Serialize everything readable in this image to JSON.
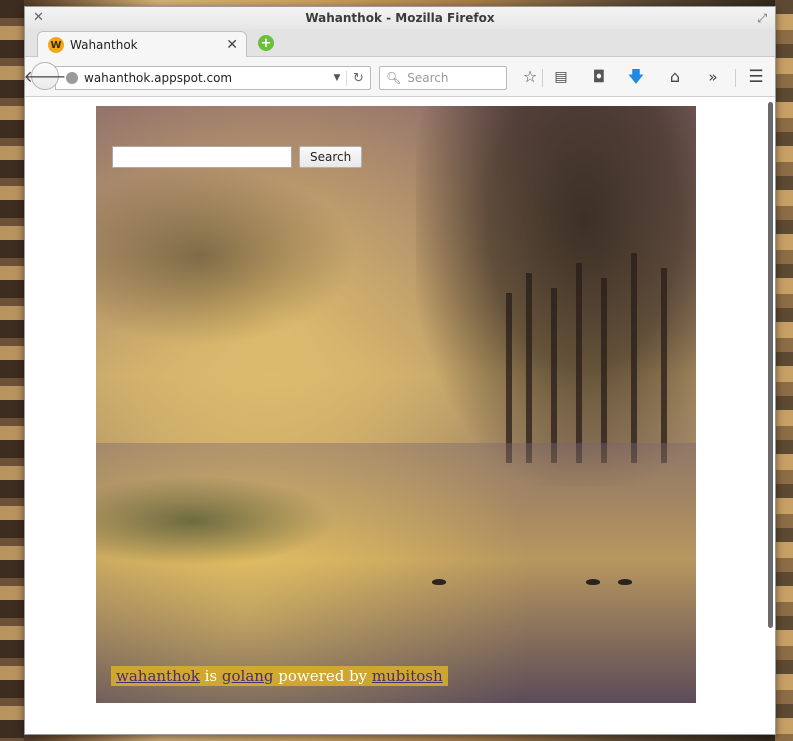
{
  "window": {
    "title": "Wahanthok - Mozilla Firefox"
  },
  "tab": {
    "favicon_letter": "W",
    "title": "Wahanthok"
  },
  "navbar": {
    "url": "wahanthok.appspot.com",
    "search_placeholder": "Search"
  },
  "page": {
    "search_button_label": "Search",
    "search_value": "",
    "footer": {
      "link1": "wahanthok",
      "text1": " is ",
      "link2": "golang",
      "text2": " powered by ",
      "link3": "mubitosh"
    }
  },
  "colors": {
    "accent_download": "#1e88e5",
    "new_tab_green": "#6abf3b",
    "favicon_orange": "#f0a81b",
    "footer_highlight": "#dcaf28",
    "link_color": "#4a2d6e"
  },
  "icons": {
    "back": "back-arrow-icon",
    "globe": "globe-icon",
    "reload": "reload-icon",
    "search": "search-icon",
    "bookmark": "star-icon",
    "reading_list": "reading-list-icon",
    "pocket": "pocket-icon",
    "download": "download-arrow-icon",
    "home": "home-icon",
    "overflow": "chevron-double-right-icon",
    "menu": "hamburger-menu-icon"
  }
}
